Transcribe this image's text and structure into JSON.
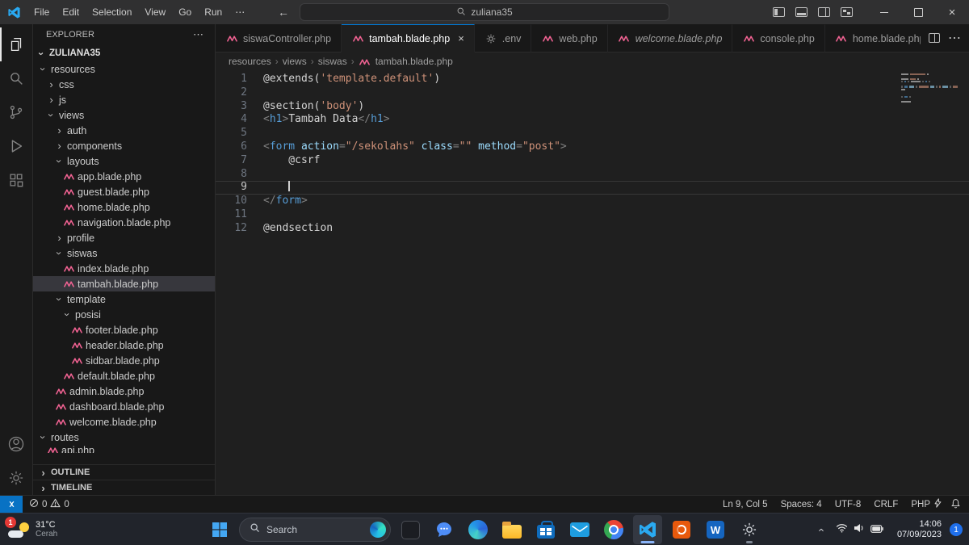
{
  "glyphs": {
    "chevron": "›",
    "close": "×",
    "more": "⋯"
  },
  "titlebar": {
    "menus": [
      "File",
      "Edit",
      "Selection",
      "View",
      "Go",
      "Run",
      "⋯"
    ],
    "back": "←",
    "forward": "→",
    "search_value": "zuliana35"
  },
  "sidebar": {
    "header": "EXPLORER",
    "project": "ZULIANA35",
    "sections": [
      "OUTLINE",
      "TIMELINE"
    ],
    "tree": [
      {
        "label": "resources",
        "indent": 1,
        "type": "folder",
        "expanded": true
      },
      {
        "label": "css",
        "indent": 2,
        "type": "folder",
        "expanded": false
      },
      {
        "label": "js",
        "indent": 2,
        "type": "folder",
        "expanded": false
      },
      {
        "label": "views",
        "indent": 2,
        "type": "folder",
        "expanded": true
      },
      {
        "label": "auth",
        "indent": 3,
        "type": "folder",
        "expanded": false
      },
      {
        "label": "components",
        "indent": 3,
        "type": "folder",
        "expanded": false
      },
      {
        "label": "layouts",
        "indent": 3,
        "type": "folder",
        "expanded": true
      },
      {
        "label": "app.blade.php",
        "indent": 4,
        "type": "file",
        "icon": "blade"
      },
      {
        "label": "guest.blade.php",
        "indent": 4,
        "type": "file",
        "icon": "blade"
      },
      {
        "label": "home.blade.php",
        "indent": 4,
        "type": "file",
        "icon": "blade"
      },
      {
        "label": "navigation.blade.php",
        "indent": 4,
        "type": "file",
        "icon": "blade"
      },
      {
        "label": "profile",
        "indent": 3,
        "type": "folder",
        "expanded": false
      },
      {
        "label": "siswas",
        "indent": 3,
        "type": "folder",
        "expanded": true
      },
      {
        "label": "index.blade.php",
        "indent": 4,
        "type": "file",
        "icon": "blade"
      },
      {
        "label": "tambah.blade.php",
        "indent": 4,
        "type": "file",
        "icon": "blade",
        "selected": true
      },
      {
        "label": "template",
        "indent": 3,
        "type": "folder",
        "expanded": true
      },
      {
        "label": "posisi",
        "indent": 4,
        "type": "folder",
        "expanded": true
      },
      {
        "label": "footer.blade.php",
        "indent": 5,
        "type": "file",
        "icon": "blade"
      },
      {
        "label": "header.blade.php",
        "indent": 5,
        "type": "file",
        "icon": "blade"
      },
      {
        "label": "sidbar.blade.php",
        "indent": 5,
        "type": "file",
        "icon": "blade"
      },
      {
        "label": "default.blade.php",
        "indent": 4,
        "type": "file",
        "icon": "blade"
      },
      {
        "label": "admin.blade.php",
        "indent": 3,
        "type": "file",
        "icon": "blade"
      },
      {
        "label": "dashboard.blade.php",
        "indent": 3,
        "type": "file",
        "icon": "blade"
      },
      {
        "label": "welcome.blade.php",
        "indent": 3,
        "type": "file",
        "icon": "blade"
      },
      {
        "label": "routes",
        "indent": 1,
        "type": "folder",
        "expanded": true
      },
      {
        "label": "api.php",
        "indent": 2,
        "type": "file",
        "icon": "blade",
        "clipped": true
      }
    ]
  },
  "tabs": [
    {
      "label": "siswaController.php",
      "icon": "blade"
    },
    {
      "label": "tambah.blade.php",
      "icon": "blade",
      "active": true
    },
    {
      "label": ".env",
      "icon": "gear"
    },
    {
      "label": "web.php",
      "icon": "blade"
    },
    {
      "label": "welcome.blade.php",
      "icon": "blade",
      "italic": true
    },
    {
      "label": "console.php",
      "icon": "blade"
    },
    {
      "label": "home.blade.php",
      "icon": "blade"
    }
  ],
  "breadcrumbs": [
    "resources",
    "views",
    "siswas",
    "tambah.blade.php"
  ],
  "editor": {
    "cursor_line": 9,
    "lines": [
      {
        "tokens": [
          [
            "plain",
            "@extends("
          ],
          [
            "string",
            "'template.default'"
          ],
          [
            "plain",
            ")"
          ]
        ]
      },
      {
        "tokens": []
      },
      {
        "tokens": [
          [
            "plain",
            "@section("
          ],
          [
            "string",
            "'body'"
          ],
          [
            "plain",
            ")"
          ]
        ]
      },
      {
        "tokens": [
          [
            "punct",
            "<"
          ],
          [
            "tag",
            "h1"
          ],
          [
            "punct",
            ">"
          ],
          [
            "plain",
            "Tambah Data"
          ],
          [
            "punct",
            "</"
          ],
          [
            "tag",
            "h1"
          ],
          [
            "punct",
            ">"
          ]
        ]
      },
      {
        "tokens": []
      },
      {
        "tokens": [
          [
            "punct",
            "<"
          ],
          [
            "tag",
            "form"
          ],
          [
            "attr",
            " action"
          ],
          [
            "punct",
            "="
          ],
          [
            "string",
            "\"/sekolahs\""
          ],
          [
            "attr",
            " class"
          ],
          [
            "punct",
            "="
          ],
          [
            "string",
            "\"\""
          ],
          [
            "attr",
            " method"
          ],
          [
            "punct",
            "="
          ],
          [
            "string",
            "\"post\""
          ],
          [
            "punct",
            ">"
          ]
        ]
      },
      {
        "tokens": [
          [
            "plain",
            "    @csrf"
          ]
        ]
      },
      {
        "tokens": []
      },
      {
        "tokens": [
          [
            "plain",
            "    "
          ]
        ],
        "cursor": true
      },
      {
        "tokens": [
          [
            "punct",
            "</"
          ],
          [
            "tag",
            "form"
          ],
          [
            "punct",
            ">"
          ]
        ]
      },
      {
        "tokens": []
      },
      {
        "tokens": [
          [
            "plain",
            "@endsection"
          ]
        ]
      }
    ]
  },
  "status_bar": {
    "errors": "0",
    "warnings": "0",
    "cursor": "Ln 9, Col 5",
    "indent": "Spaces: 4",
    "encoding": "UTF-8",
    "eol": "CRLF",
    "lang": "PHP"
  },
  "taskbar": {
    "badge": "1",
    "temp": "31°C",
    "desc": "Cerah",
    "search": "Search",
    "word_logo": "W",
    "time": "14:06",
    "date": "07/09/2023",
    "notifications": "1"
  }
}
